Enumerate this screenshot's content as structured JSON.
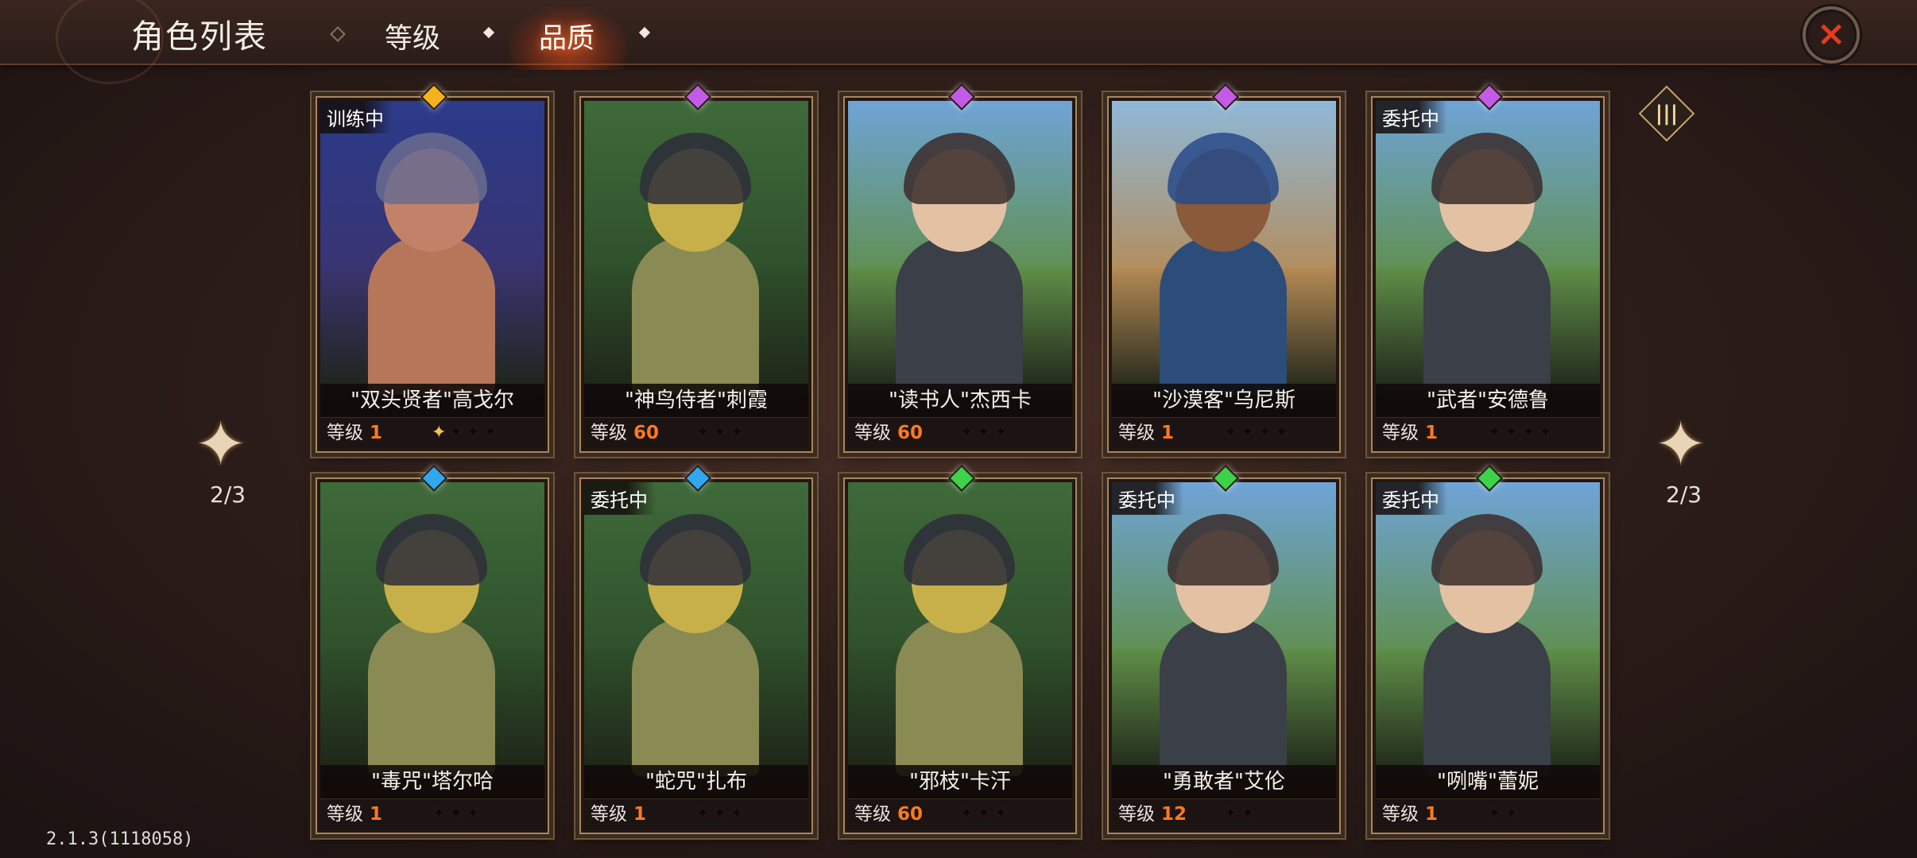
{
  "header": {
    "title": "角色列表",
    "tabs": [
      {
        "label": "等级",
        "active": false
      },
      {
        "label": "品质",
        "active": true
      }
    ],
    "close_icon": "close-x-icon"
  },
  "level_label": "等级",
  "cards": [
    {
      "name": "\"双头贤者\"高戈尔",
      "level": "1",
      "status": "训练中",
      "gem_color": "#f4b31a",
      "stars_total": 4,
      "stars_lit": 1,
      "theme": "night"
    },
    {
      "name": "\"神鸟侍者\"刺霞",
      "level": "60",
      "status": "",
      "gem_color": "#c45be6",
      "stars_total": 3,
      "stars_lit": 0,
      "theme": "forest"
    },
    {
      "name": "\"读书人\"杰西卡",
      "level": "60",
      "status": "",
      "gem_color": "#c45be6",
      "stars_total": 3,
      "stars_lit": 0,
      "theme": "sky"
    },
    {
      "name": "\"沙漠客\"乌尼斯",
      "level": "1",
      "status": "",
      "gem_color": "#c45be6",
      "stars_total": 4,
      "stars_lit": 0,
      "theme": "desert"
    },
    {
      "name": "\"武者\"安德鲁",
      "level": "1",
      "status": "委托中",
      "gem_color": "#c45be6",
      "stars_total": 4,
      "stars_lit": 0,
      "theme": "sky"
    },
    {
      "name": "\"毒咒\"塔尔哈",
      "level": "1",
      "status": "",
      "gem_color": "#2fa8f0",
      "stars_total": 3,
      "stars_lit": 0,
      "theme": "forest"
    },
    {
      "name": "\"蛇咒\"扎布",
      "level": "1",
      "status": "委托中",
      "gem_color": "#2fa8f0",
      "stars_total": 3,
      "stars_lit": 0,
      "theme": "forest"
    },
    {
      "name": "\"邪枝\"卡汗",
      "level": "60",
      "status": "",
      "gem_color": "#3cd34a",
      "stars_total": 3,
      "stars_lit": 0,
      "theme": "forest"
    },
    {
      "name": "\"勇敢者\"艾伦",
      "level": "12",
      "status": "委托中",
      "gem_color": "#3cd34a",
      "stars_total": 2,
      "stars_lit": 0,
      "theme": "sky"
    },
    {
      "name": "\"咧嘴\"蕾妮",
      "level": "1",
      "status": "委托中",
      "gem_color": "#3cd34a",
      "stars_total": 2,
      "stars_lit": 0,
      "theme": "sky"
    }
  ],
  "pagination": {
    "left": "2/3",
    "right": "2/3"
  },
  "column_toggle_icon": "columns-icon",
  "version": "2.1.3(1118058)"
}
